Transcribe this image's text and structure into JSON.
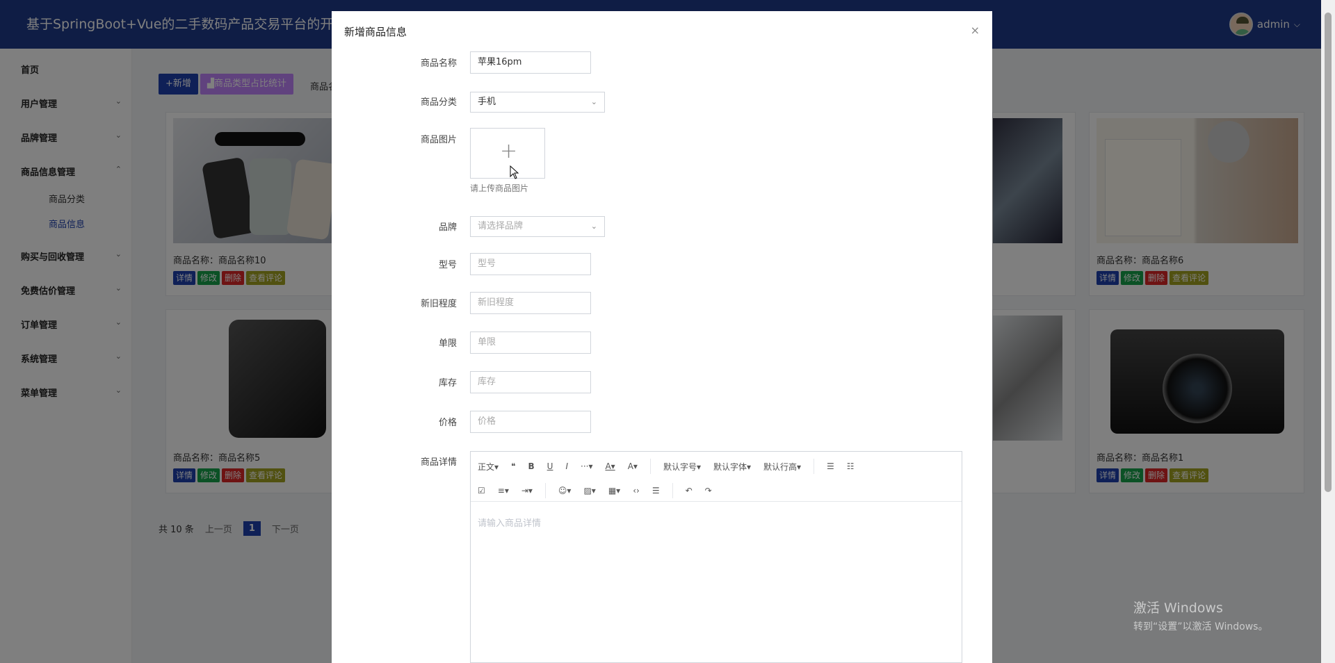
{
  "header": {
    "title": "基于SpringBoot+Vue的二手数码产品交易平台的开发",
    "user": "admin",
    "user_chevron": "⌵"
  },
  "sidebar": {
    "items": [
      {
        "label": "首页"
      },
      {
        "label": "用户管理"
      },
      {
        "label": "品牌管理"
      },
      {
        "label": "商品信息管理"
      },
      {
        "label": "购买与回收管理"
      },
      {
        "label": "免费估价管理"
      },
      {
        "label": "订单管理"
      },
      {
        "label": "系统管理"
      },
      {
        "label": "菜单管理"
      }
    ],
    "sub_items": [
      {
        "label": "商品分类"
      },
      {
        "label": "商品信息"
      }
    ],
    "chev_down": "⌄",
    "chev_up": "⌃"
  },
  "main": {
    "add_button": "+新增",
    "stat_button": "▟商品类型占比统计",
    "filter_label": "商品名",
    "cards": [
      {
        "name": "商品名称：商品名称10"
      },
      {
        "name": "商品名称：商品名称6"
      },
      {
        "name": "商品名称：商品名称5"
      },
      {
        "name": "商品名称：商品名称1"
      }
    ],
    "op_labels": {
      "detail": "详情",
      "edit": "修改",
      "delete": "删除",
      "review": "查看评论"
    },
    "pager": {
      "total": "共 10 条",
      "prev": "上一页",
      "current": "1",
      "next": "下一页"
    }
  },
  "dialog": {
    "title": "新增商品信息",
    "close": "×",
    "fields": {
      "name_label": "商品名称",
      "name_value": "苹果16pm",
      "category_label": "商品分类",
      "category_value": "手机",
      "image_label": "商品图片",
      "image_tip": "请上传商品图片",
      "image_plus": "+",
      "brand_label": "品牌",
      "brand_placeholder": "请选择品牌",
      "model_label": "型号",
      "model_placeholder": "型号",
      "condition_label": "新旧程度",
      "condition_placeholder": "新旧程度",
      "limit_label": "单限",
      "limit_placeholder": "单限",
      "stock_label": "库存",
      "stock_placeholder": "库存",
      "price_label": "价格",
      "price_placeholder": "价格",
      "detail_label": "商品详情",
      "detail_placeholder": "请输入商品详情"
    },
    "toolbar": {
      "paragraph": "正文▾",
      "quote": "❝",
      "bold": "B",
      "underline": "U",
      "italic": "I",
      "more": "···▾",
      "font_color": "A▾",
      "bg_color": "A▾",
      "font_size": "默认字号▾",
      "font_family": "默认字体▾",
      "line_height": "默认行高▾",
      "ul": "☰",
      "ol": "☷",
      "todo": "☑",
      "align": "≡▾",
      "indent": "⇥▾",
      "emoji": "☺▾",
      "image": "▨▾",
      "table": "▦▾",
      "code": "‹›",
      "divider": "☰",
      "undo": "↶",
      "redo": "↷"
    }
  },
  "watermark": {
    "line1": "激活 Windows",
    "line2": "转到“设置”以激活 Windows。"
  }
}
